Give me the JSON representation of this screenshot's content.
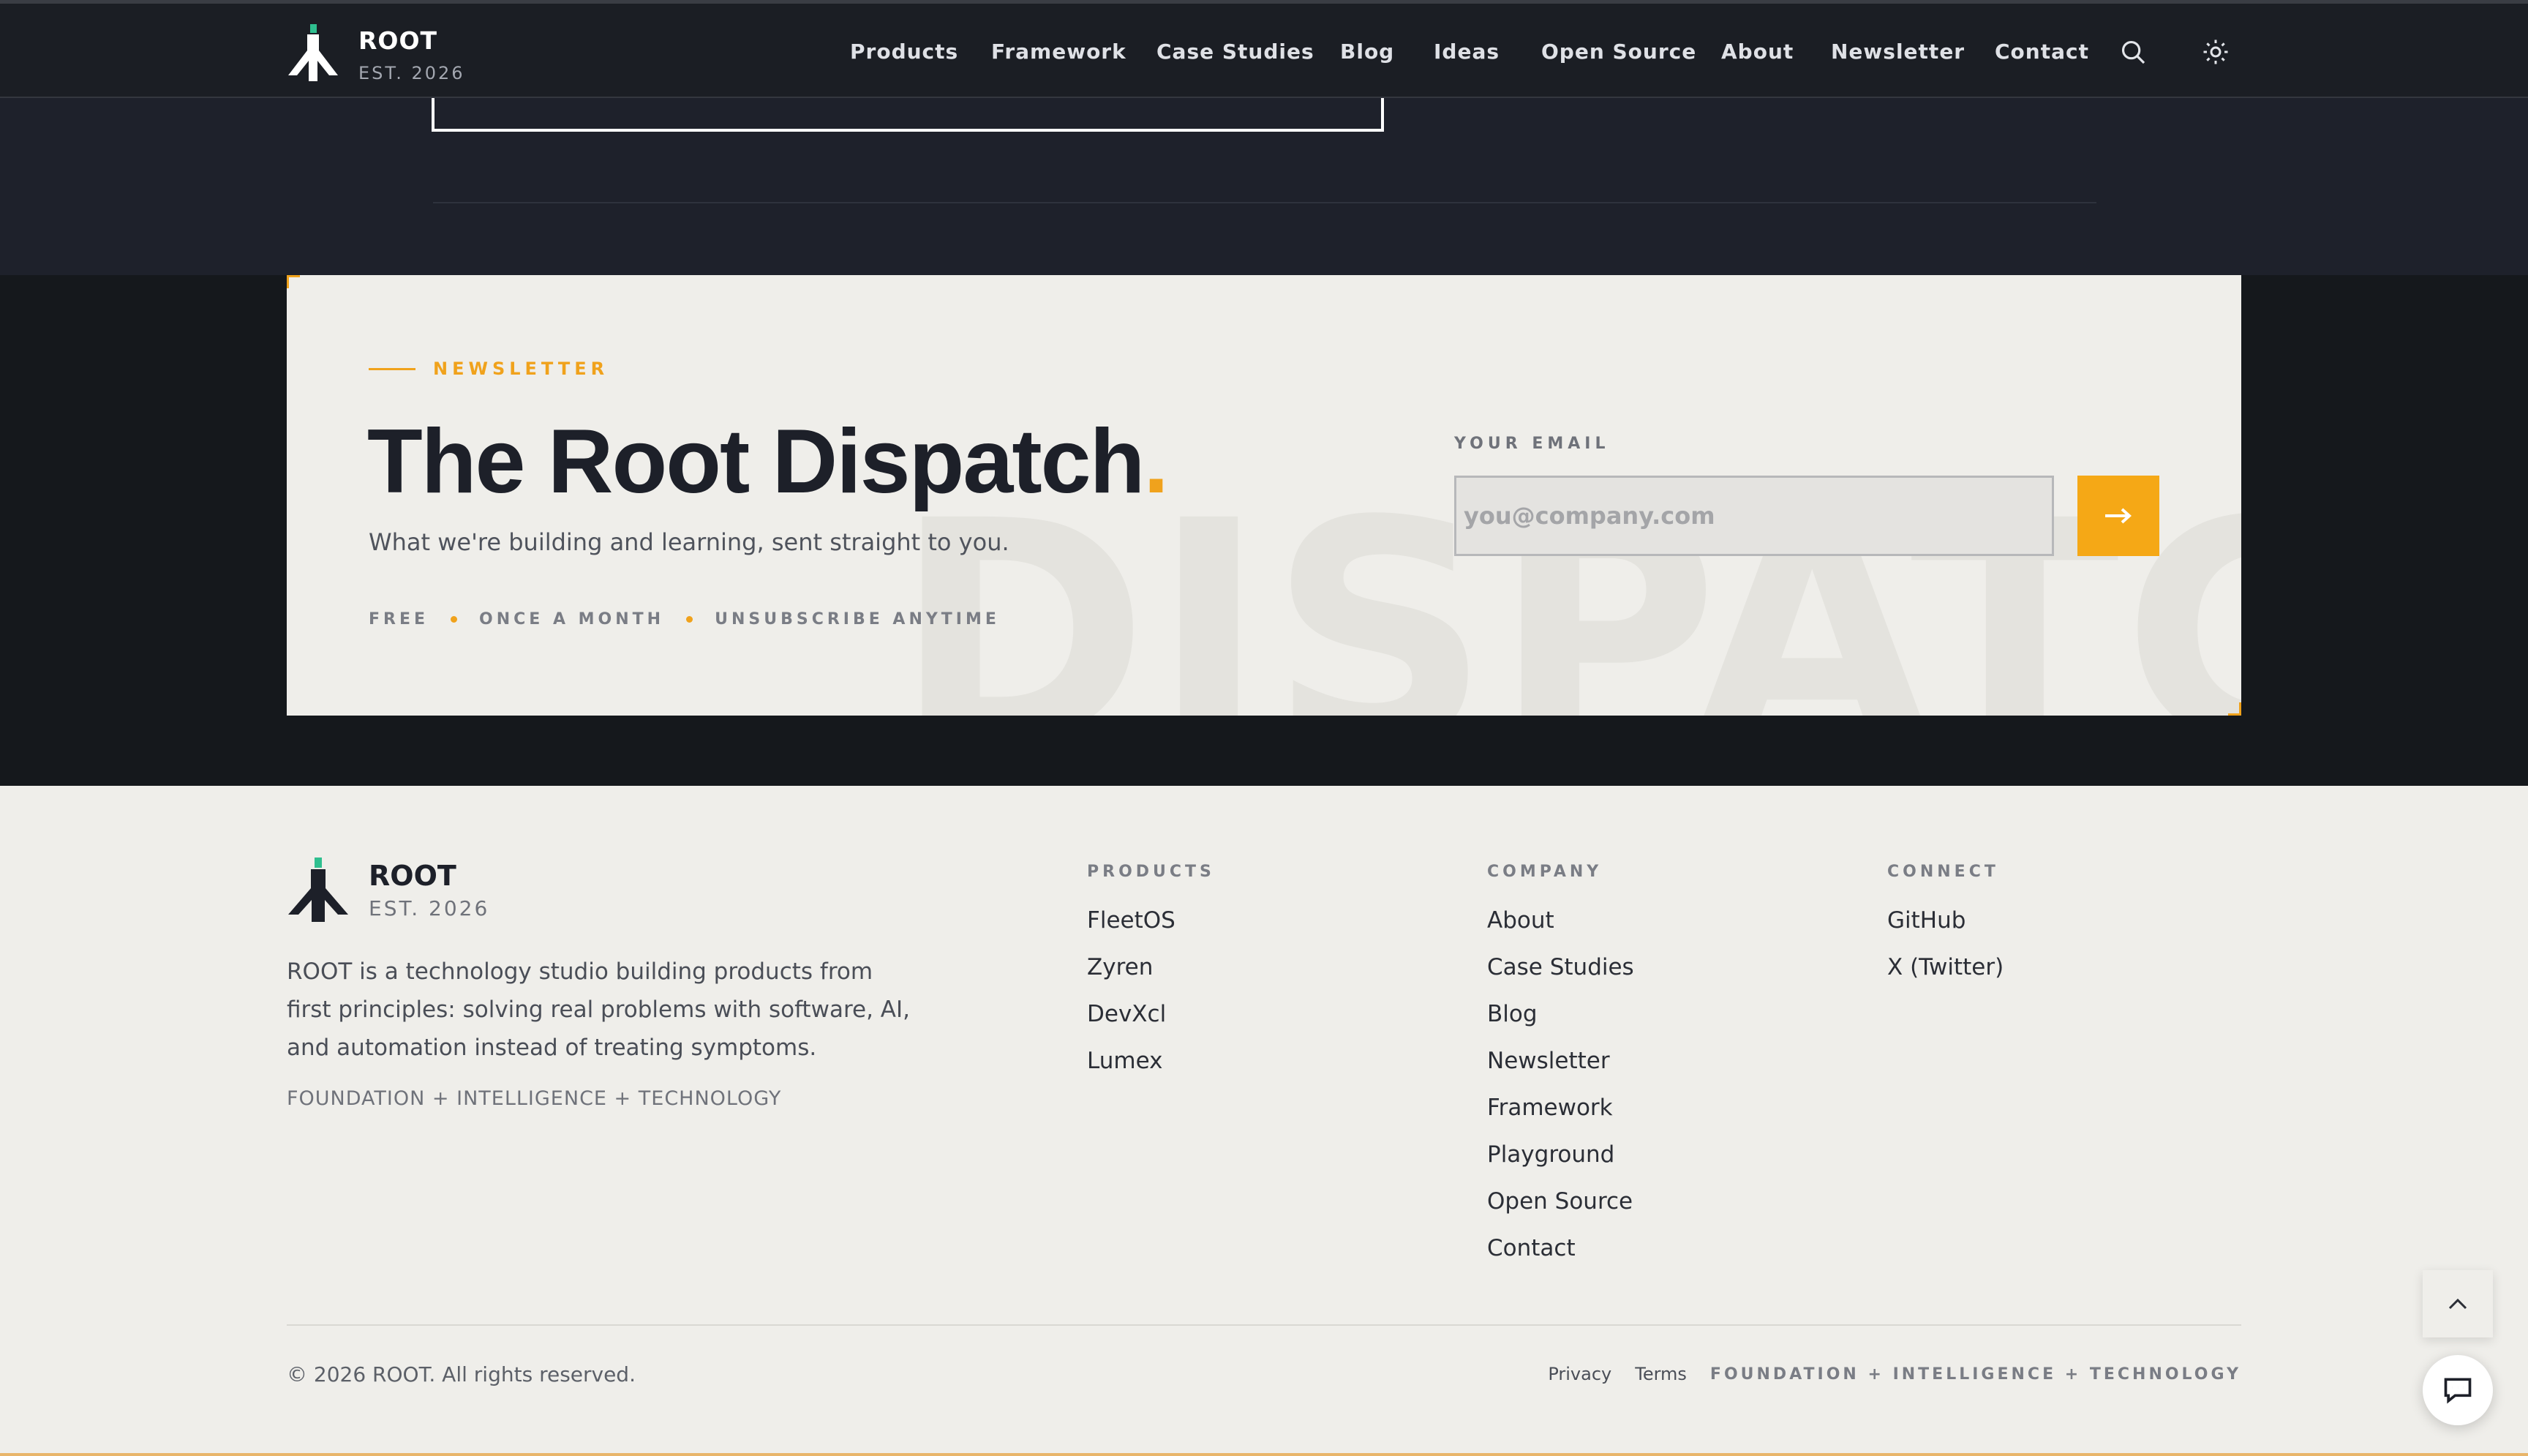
{
  "header": {
    "logo_name": "ROOT",
    "logo_est": "EST. 2026",
    "nav": [
      "Products",
      "Framework",
      "Case Studies",
      "Blog",
      "Ideas",
      "Open Source",
      "About",
      "Newsletter",
      "Contact"
    ],
    "search_icon": "search-icon",
    "theme_icon": "sun-icon"
  },
  "newsletter": {
    "eyebrow": "NEWSLETTER",
    "title": "The Root Dispatch",
    "title_dot": ".",
    "subtitle": "What we're building and learning, sent straight to you.",
    "tags": [
      "FREE",
      "ONCE A MONTH",
      "UNSUBSCRIBE ANYTIME"
    ],
    "watermark": "DISPATCH",
    "email_label": "YOUR EMAIL",
    "email_placeholder": "you@company.com",
    "email_value": "",
    "submit_icon": "arrow-right-icon"
  },
  "footer": {
    "logo_name": "ROOT",
    "logo_est": "EST. 2026",
    "description": "ROOT is a technology studio building products from first principles: solving real problems with software, AI, and automation instead of treating symptoms.",
    "motto": "FOUNDATION + INTELLIGENCE + TECHNOLOGY",
    "columns": [
      {
        "title": "PRODUCTS",
        "links": [
          "FleetOS",
          "Zyren",
          "DevXcl",
          "Lumex"
        ]
      },
      {
        "title": "COMPANY",
        "links": [
          "About",
          "Case Studies",
          "Blog",
          "Newsletter",
          "Framework",
          "Playground",
          "Open Source",
          "Contact"
        ]
      },
      {
        "title": "CONNECT",
        "links": [
          "GitHub",
          "X (Twitter)"
        ]
      }
    ],
    "copyright": "© 2026 ROOT. All rights reserved.",
    "privacy": "Privacy",
    "terms": "Terms",
    "motto_small": "FOUNDATION + INTELLIGENCE + TECHNOLOGY"
  },
  "floating": {
    "scroll_top_icon": "chevron-up-icon",
    "chat_icon": "chat-icon"
  },
  "colors": {
    "accent": "#f0a21c",
    "dark_bg": "#1e212b",
    "light_bg": "#efeeea",
    "logo_green": "#2fbf8f"
  }
}
